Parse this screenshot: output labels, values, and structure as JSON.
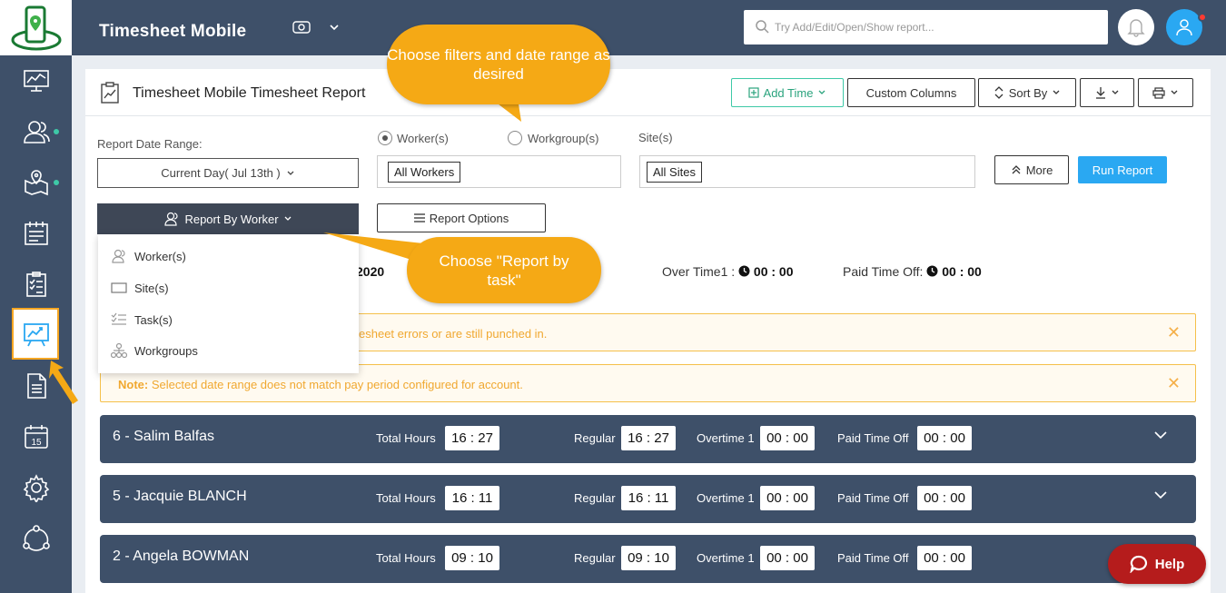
{
  "app": {
    "title": "Timesheet Mobile"
  },
  "search": {
    "placeholder": "Try Add/Edit/Open/Show report..."
  },
  "report": {
    "title": "Timesheet Mobile Timesheet Report",
    "toolbar": {
      "add_time": "Add Time",
      "custom_columns": "Custom Columns",
      "sort_by": "Sort By"
    },
    "filters": {
      "date_range_label": "Report Date Range:",
      "date_range_value": "Current Day( Jul 13th )",
      "worker_radio": "Worker(s)",
      "workgroup_radio": "Workgroup(s)",
      "sites_label": "Site(s)",
      "workers_chip": "All Workers",
      "sites_chip": "All Sites",
      "more": "More",
      "run": "Run Report",
      "report_by": "Report By Worker",
      "report_options": "Report Options"
    },
    "menu": [
      "Worker(s)",
      "Site(s)",
      "Task(s)",
      "Workgroups"
    ],
    "summary": {
      "date_fragment": "2020",
      "overtime_label": "Over Time1 :",
      "overtime_value": "00 : 00",
      "pto_label": "Paid Time Off:",
      "pto_value": "00 : 00"
    },
    "alerts": [
      {
        "text": "esheet errors or are still punched in."
      },
      {
        "note_label": "Note:",
        "text": " Selected date range does not match pay period configured for account."
      }
    ],
    "row_labels": {
      "total": "Total Hours",
      "regular": "Regular",
      "overtime": "Overtime 1",
      "pto": "Paid Time Off"
    },
    "workers": [
      {
        "name": "6 - Salim Balfas",
        "total": "16 : 27",
        "regular": "16 : 27",
        "overtime": "00 : 00",
        "pto": "00 : 00"
      },
      {
        "name": "5 - Jacquie BLANCH",
        "total": "16 : 11",
        "regular": "16 : 11",
        "overtime": "00 : 00",
        "pto": "00 : 00"
      },
      {
        "name": "2 - Angela BOWMAN",
        "total": "09 : 10",
        "regular": "09 : 10",
        "overtime": "00 : 00",
        "pto": "00 : 00"
      }
    ]
  },
  "callouts": {
    "filters": "Choose filters and date range as desired",
    "task": "Choose \"Report by task\""
  },
  "help": {
    "label": "Help"
  },
  "colors": {
    "sidebar": "#3e5069",
    "accent_blue": "#2aa8f2",
    "callout": "#f5a915",
    "teal": "#3ec9a7",
    "help": "#b51c1c"
  }
}
